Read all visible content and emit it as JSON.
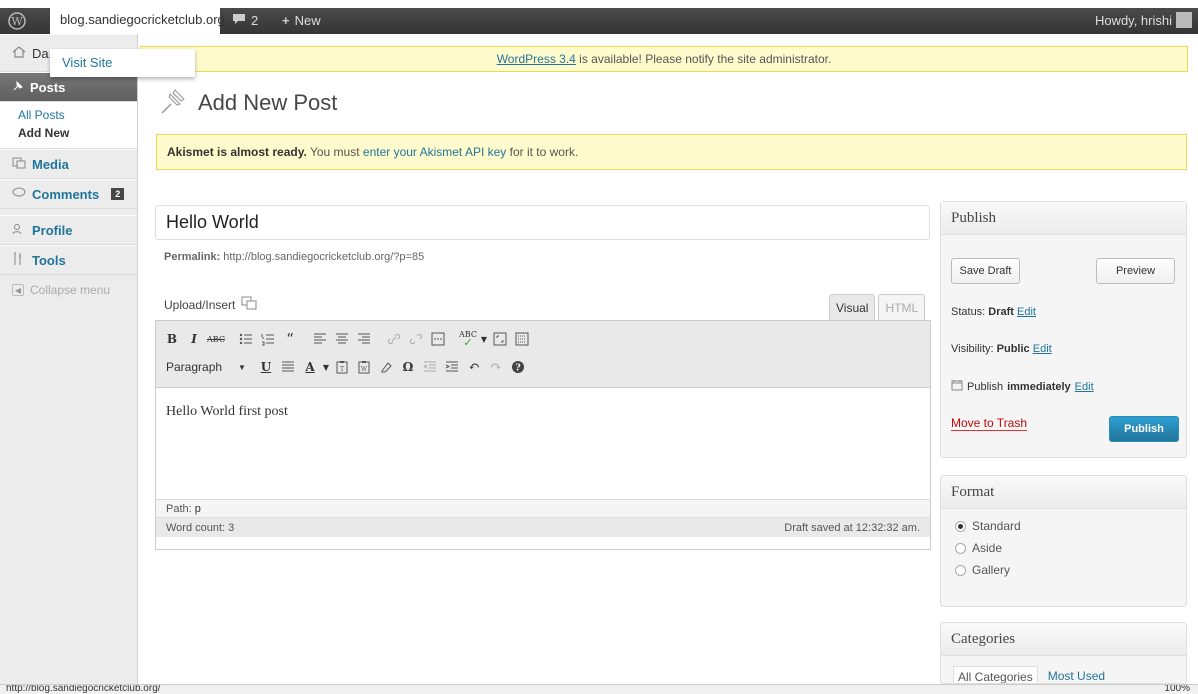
{
  "adminbar": {
    "site_name": "blog.sandiegocricketclub.org",
    "comments_count": "2",
    "new_label": "New",
    "howdy": "Howdy, hrishi"
  },
  "site_dropdown": {
    "visit_site": "Visit Site"
  },
  "sidebar": {
    "dashboard": "Da",
    "posts": "Posts",
    "submenu": [
      "All Posts",
      "Add New"
    ],
    "media": "Media",
    "comments": "Comments",
    "comments_badge": "2",
    "profile": "Profile",
    "tools": "Tools",
    "collapse": "Collapse menu"
  },
  "notices": {
    "update_link": "WordPress 3.4",
    "update_text": " is available! Please notify the site administrator.",
    "akismet_bold": "Akismet is almost ready.",
    "akismet_text1": " You must ",
    "akismet_link": "enter your Akismet API key",
    "akismet_text2": " for it to work."
  },
  "page": {
    "title": "Add New Post"
  },
  "post": {
    "title": "Hello World",
    "permalink_label": "Permalink:",
    "permalink_url": " http://blog.sandiegocricketclub.org/?p=85",
    "upload_insert": "Upload/Insert",
    "tab_visual": "Visual",
    "tab_html": "HTML",
    "format_select": "Paragraph",
    "content": "Hello World first post",
    "path_label": "Path: ",
    "path_value": "p",
    "word_count": "Word count: 3",
    "draft_saved": "Draft saved at 12:32:32 am."
  },
  "publish": {
    "heading": "Publish",
    "save_draft": "Save Draft",
    "preview": "Preview",
    "status_label": "Status: ",
    "status_value": "Draft",
    "visibility_label": "Visibility: ",
    "visibility_value": "Public",
    "publish_label": "Publish ",
    "publish_value": "immediately",
    "edit": "Edit",
    "trash": "Move to Trash",
    "publish_button": "Publish"
  },
  "format": {
    "heading": "Format",
    "options": [
      "Standard",
      "Aside",
      "Gallery"
    ],
    "selected": "Standard"
  },
  "categories": {
    "heading": "Categories",
    "tab_all": "All Categories",
    "tab_most": "Most Used"
  },
  "statusbar": {
    "url": "http://blog.sandiegocricketclub.org/",
    "zoom": "100%"
  },
  "colors": {
    "link": "#21759b",
    "notice_bg": "#fffbcc",
    "primary_button": "#21759b",
    "adminbar": "#464646"
  }
}
